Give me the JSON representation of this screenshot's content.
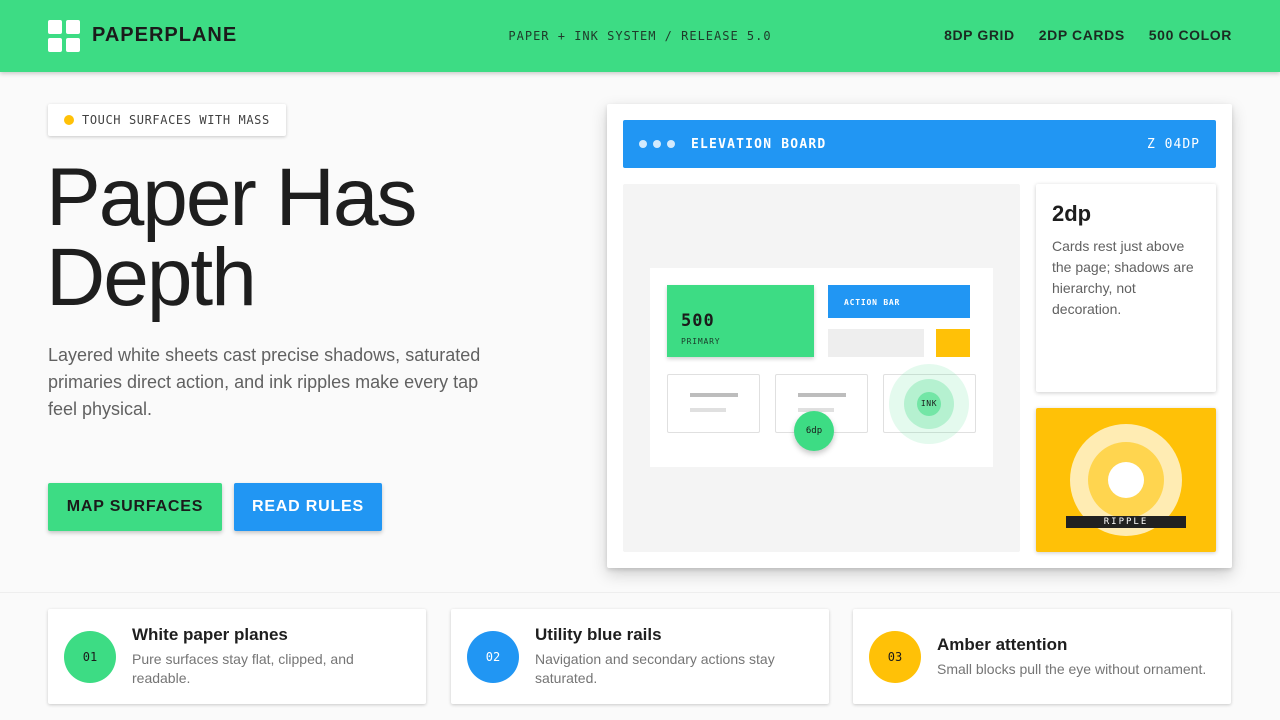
{
  "header": {
    "brand": "PAPERPLANE",
    "tagline": "PAPER + INK SYSTEM / RELEASE 5.0",
    "nav": [
      "8DP GRID",
      "2DP CARDS",
      "500 COLOR"
    ],
    "accent": "#3ddc84"
  },
  "hero": {
    "chip": "TOUCH SURFACES WITH MASS",
    "headline": "Paper Has Depth",
    "lede": "Layered white sheets cast precise shadows, saturated primaries direct action, and ink ripples make every tap feel physical.",
    "primary_cta": "MAP SURFACES",
    "secondary_cta": "READ RULES"
  },
  "board": {
    "title": "ELEVATION BOARD",
    "elevation": "Z 04DP",
    "primary_value": "500",
    "primary_label": "PRIMARY",
    "action_bar": "ACTION BAR",
    "fab_label": "6dp",
    "ink_label": "INK",
    "side_card": {
      "title": "2dp",
      "body": "Cards rest just above the page; shadows are hierarchy, not decoration."
    },
    "ripple_label": "RIPPLE"
  },
  "features": [
    {
      "num": "01",
      "title": "White paper planes",
      "body": "Pure surfaces stay flat, clipped, and readable.",
      "color": "#3ddc84"
    },
    {
      "num": "02",
      "title": "Utility blue rails",
      "body": "Navigation and secondary actions stay saturated.",
      "color": "#2196f3"
    },
    {
      "num": "03",
      "title": "Amber attention",
      "body": "Small blocks pull the eye without ornament.",
      "color": "#ffc107"
    }
  ],
  "colors": {
    "green": "#3ddc84",
    "blue": "#2196f3",
    "amber": "#ffc107"
  }
}
